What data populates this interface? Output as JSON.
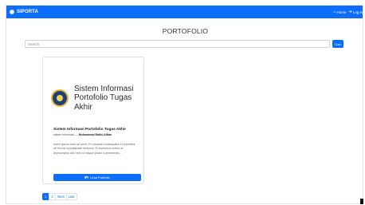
{
  "navbar": {
    "brand": "SIPORTA",
    "links": [
      {
        "icon": "home-icon",
        "label": "Home"
      },
      {
        "icon": "login-icon",
        "label": "Log in"
      }
    ]
  },
  "page": {
    "title": "PORTOFOLIO"
  },
  "search": {
    "placeholder": "Search",
    "button_label": "Cari"
  },
  "cards": [
    {
      "cover_title_lines": [
        "Sistem Informasi",
        "Portofolio Tugas",
        "Akhir"
      ],
      "title": "Sistem Informasi Portofolio Tugas Akhir",
      "category": "sistem informasi",
      "author": "Muhammad Rakhi Alfian",
      "description": "lorem ipsum dolor sit amet. Et voluptati consequatur et provident off hic est repudiandae tempora. Et lincentura dolore at deproceptus dict recto ut eaque ipsam a perferendis...",
      "button_label": "Lihat Portfolio"
    }
  ],
  "pagination": {
    "pages": [
      "1",
      "2"
    ],
    "next": "Next",
    "last": "Last"
  }
}
